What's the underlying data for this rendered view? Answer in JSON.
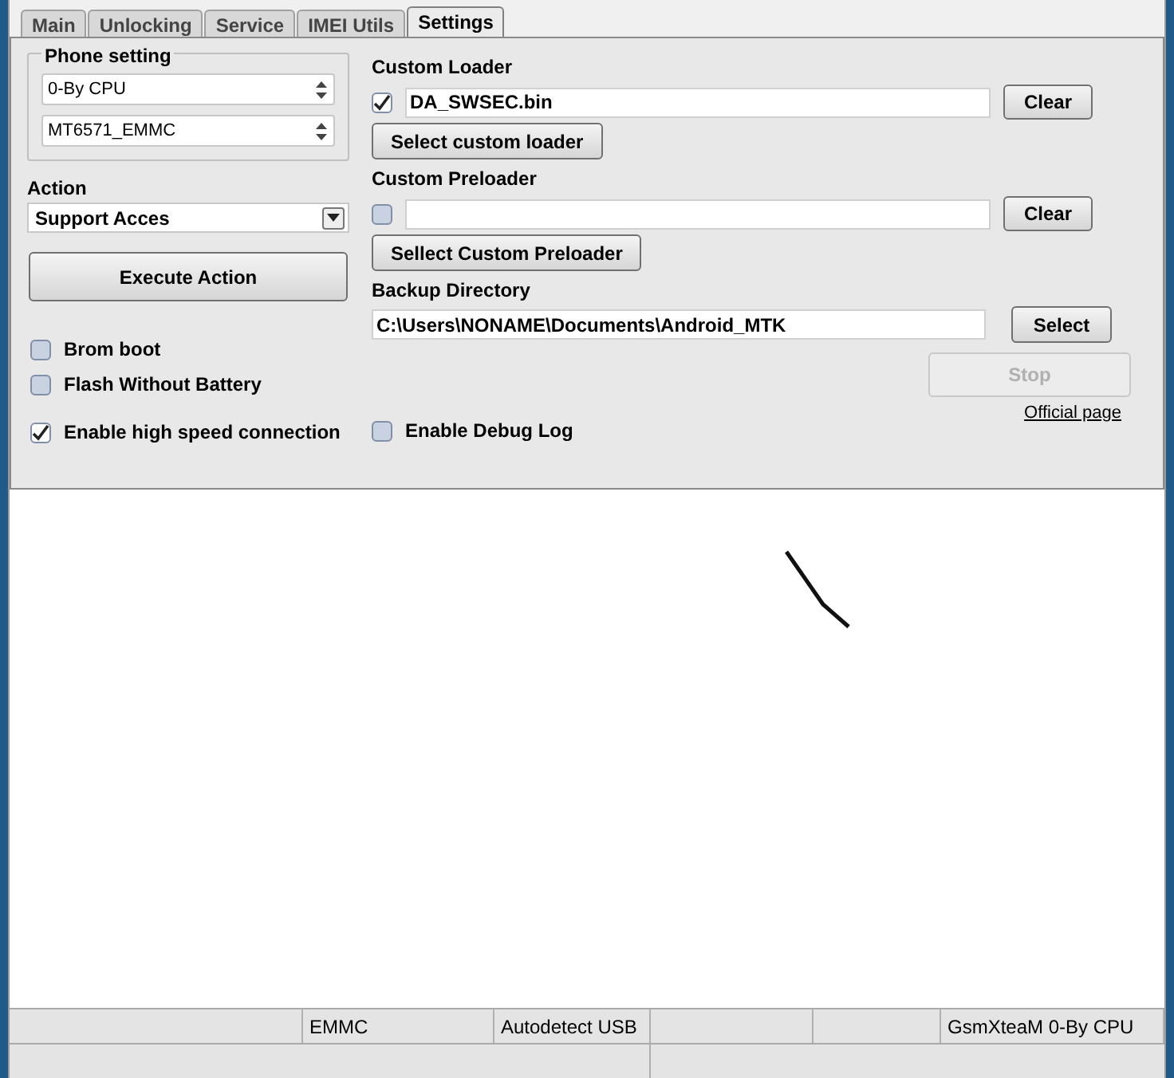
{
  "tabs": [
    {
      "label": "Main",
      "selected": false
    },
    {
      "label": "Unlocking",
      "selected": false
    },
    {
      "label": "Service",
      "selected": false
    },
    {
      "label": "IMEI Utils",
      "selected": false
    },
    {
      "label": "Settings",
      "selected": true
    }
  ],
  "phone_setting": {
    "title": "Phone setting",
    "selects": [
      "0-By CPU",
      "MT6571_EMMC"
    ]
  },
  "action": {
    "label": "Action",
    "value": "Support Acces",
    "button": "Execute Action"
  },
  "options": [
    {
      "label": "Brom boot",
      "checked": false
    },
    {
      "label": "Flash Without Battery",
      "checked": false
    }
  ],
  "high_speed": {
    "label": "Enable high speed connection",
    "checked": true
  },
  "debug_log": {
    "label": "Enable Debug Log",
    "checked": false
  },
  "custom_loader": {
    "label": "Custom Loader",
    "checked": true,
    "value": "DA_SWSEC.bin",
    "clear": "Clear",
    "select": "Select custom loader"
  },
  "custom_preloader": {
    "label": "Custom Preloader",
    "checked": false,
    "clear": "Clear",
    "select": "Sellect Custom Preloader"
  },
  "backup": {
    "label": "Backup Directory",
    "value": "C:\\Users\\NONAME\\Documents\\Android_MTK",
    "select": "Select"
  },
  "stop": {
    "label": "Stop",
    "disabled": true
  },
  "official_link": "Official page",
  "status_bar": [
    "EMMC",
    "Autodetect USB",
    "GsmXteaM 0-By CPU"
  ]
}
